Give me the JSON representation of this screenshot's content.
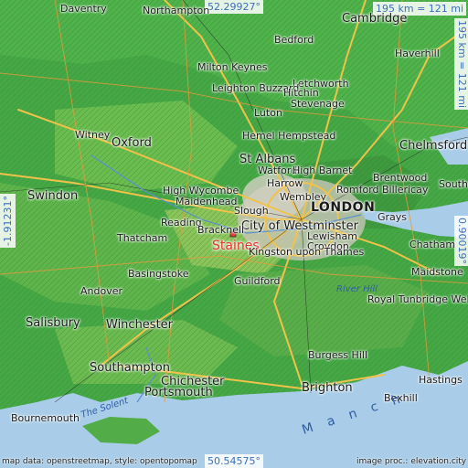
{
  "coords": {
    "lat_top": "52.29927°",
    "lat_bottom": "50.54575°",
    "lon_left": "-1.91231°",
    "lon_right": "0.90019°",
    "scale": "195 km = 121 mi",
    "scale_vertical": "195 km = 121 mi"
  },
  "attribution": {
    "left": "map data: openstreetmap, style: opentopomap",
    "right": "image proc.: elevation.city"
  },
  "highlight": "Staines",
  "places": {
    "london": "LONDON",
    "city_westminster": "City of Westminster",
    "cambridge": "Cambridge",
    "bedford": "Bedford",
    "northampton": "Northampton",
    "daventry": "Daventry",
    "milton_keynes": "Milton Keynes",
    "leighton_buzzard": "Leighton Buzzard",
    "luton": "Luton",
    "hitchin": "Hitchin",
    "letchworth": "Letchworth",
    "stevenage": "Stevenage",
    "haverhill": "Haverhill",
    "chelmsford": "Chelmsford",
    "oxford": "Oxford",
    "witney": "Witney",
    "st_albans": "St Albans",
    "hemel": "Hemel Hempstead",
    "watford": "Watford",
    "high_barnet": "High Barnet",
    "harrow": "Harrow",
    "wembley": "Wembley",
    "romford": "Romford",
    "brentwood": "Brentwood",
    "billericay": "Billericay",
    "southend": "Southend-on-Sea",
    "high_wycombe": "High Wycombe",
    "maidenhead": "Maidenhead",
    "slough": "Slough",
    "reading": "Reading",
    "bracknell": "Bracknell",
    "thatcham": "Thatcham",
    "swindon": "Swindon",
    "basingstoke": "Basingstoke",
    "andover": "Andover",
    "guildford": "Guildford",
    "kingston": "Kingston upon Thames",
    "croydon": "Croydon",
    "lewisham": "Lewisham",
    "grays": "Grays",
    "chatham": "Chatham",
    "maidstone": "Maidstone",
    "river_hill": "River Hill",
    "royal_tunbridge": "Royal Tunbridge Wells",
    "salisbury": "Salisbury",
    "winchester": "Winchester",
    "southampton": "Southampton",
    "chichester": "Chichester",
    "portsmouth": "Portsmouth",
    "bournemouth": "Bournemouth",
    "burgess_hill": "Burgess Hill",
    "brighton": "Brighton",
    "bexhill": "Bexhill",
    "hastings": "Hastings",
    "the_solent": "The Solent",
    "manche": "M a n c h"
  }
}
